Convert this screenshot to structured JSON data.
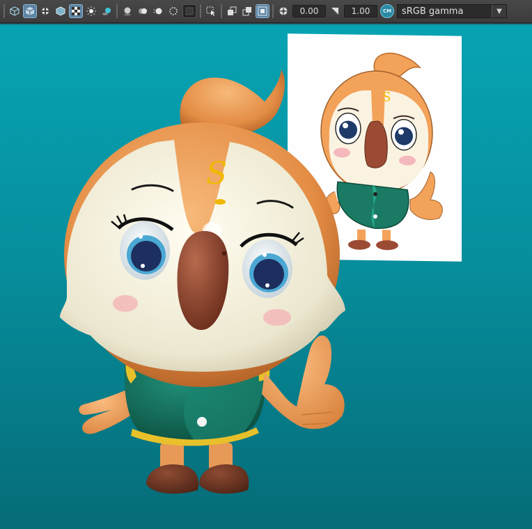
{
  "toolbar": {
    "icons": [
      "wireframe-cube-icon",
      "shaded-cube-icon",
      "texture-icon",
      "wireframe-shaded-icon",
      "checker-texture-icon",
      "light-icon",
      "shadow-icon",
      "sphere-icon",
      "ambient-occlusion-icon",
      "motion-blur-icon",
      "antialias-icon",
      "select-icon",
      "isolate-icon",
      "xray-icon",
      "backface-icon",
      "exposure-icon",
      "gamma-icon"
    ],
    "exposure_value": "0.00",
    "gamma_value": "1.00",
    "color_management_badge": "CM",
    "color_space": "sRGB gamma"
  },
  "colors": {
    "viewport_top": "#07a3b3",
    "viewport_bottom": "#066c78",
    "toolbar_bg": "#444444",
    "active_button": "#5d84a4"
  }
}
